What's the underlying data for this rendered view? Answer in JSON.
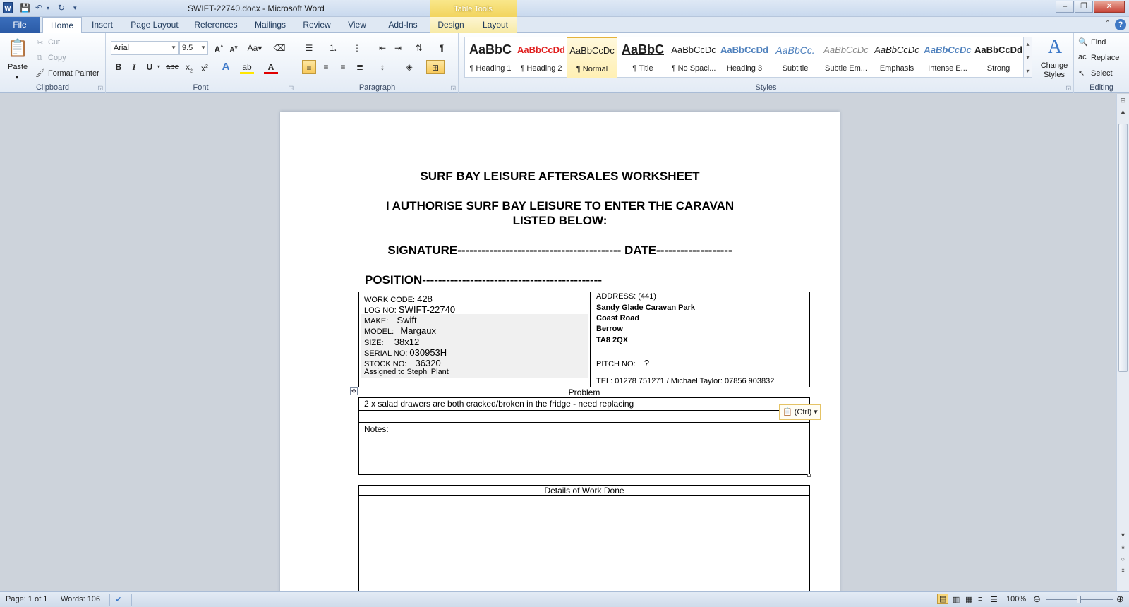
{
  "window": {
    "title": "SWIFT-22740.docx - Microsoft Word",
    "table_tools": "Table Tools",
    "app_icon": "W"
  },
  "tabs": [
    {
      "label": "File"
    },
    {
      "label": "Home"
    },
    {
      "label": "Insert"
    },
    {
      "label": "Page Layout"
    },
    {
      "label": "References"
    },
    {
      "label": "Mailings"
    },
    {
      "label": "Review"
    },
    {
      "label": "View"
    },
    {
      "label": "Add-Ins"
    },
    {
      "label": "Design"
    },
    {
      "label": "Layout"
    }
  ],
  "ribbon": {
    "clipboard": {
      "paste": "Paste",
      "cut": "Cut",
      "copy": "Copy",
      "format_painter": "Format Painter",
      "label": "Clipboard"
    },
    "font": {
      "name": "Arial",
      "size": "9.5",
      "label": "Font",
      "change_case": "Aa"
    },
    "paragraph": {
      "label": "Paragraph"
    },
    "styles": {
      "label": "Styles",
      "items": [
        {
          "preview": "AaBbC",
          "name": "¶ Heading 1"
        },
        {
          "preview": "AaBbCcDd",
          "name": "¶ Heading 2"
        },
        {
          "preview": "AaBbCcDc",
          "name": "¶ Normal"
        },
        {
          "preview": "AaBbC",
          "name": "¶ Title"
        },
        {
          "preview": "AaBbCcDc",
          "name": "¶ No Spaci..."
        },
        {
          "preview": "AaBbCcDd",
          "name": "Heading 3"
        },
        {
          "preview": "AaBbCc.",
          "name": "Subtitle"
        },
        {
          "preview": "AaBbCcDc",
          "name": "Subtle Em..."
        },
        {
          "preview": "AaBbCcDc",
          "name": "Emphasis"
        },
        {
          "preview": "AaBbCcDc",
          "name": "Intense E..."
        },
        {
          "preview": "AaBbCcDd",
          "name": "Strong"
        }
      ],
      "change_styles": "Change Styles"
    },
    "editing": {
      "find": "Find",
      "replace": "Replace",
      "select": "Select",
      "label": "Editing"
    }
  },
  "document": {
    "heading": "SURF BAY LEISURE AFTERSALES WORKSHEET",
    "authorise_line1": "I AUTHORISE SURF BAY LEISURE TO ENTER THE CARAVAN",
    "authorise_line2": "LISTED BELOW:",
    "signature_line": "SIGNATURE----------------------------------------- DATE-------------------",
    "position_line": "POSITION---------------------------------------------",
    "left_fields": [
      {
        "label": "WORK CODE:",
        "value": "428"
      },
      {
        "label": "LOG NO:",
        "value": "SWIFT-22740"
      },
      {
        "label": "MAKE:",
        "value": "Swift"
      },
      {
        "label": "MODEL:",
        "value": "Margaux"
      },
      {
        "label": "SIZE:",
        "value": "38x12"
      },
      {
        "label": "SERIAL  NO:",
        "value": "030953H"
      },
      {
        "label": "STOCK NO:",
        "value": "36320"
      }
    ],
    "assigned": "Assigned to Stephi Plant",
    "address_label": "ADDRESS:  (441)",
    "address_lines": [
      "Sandy Glade Caravan  Park",
      "Coast Road",
      "Berrow",
      "TA8 2QX"
    ],
    "pitch_label": "PITCH NO:",
    "pitch_value": "?",
    "tel": "TEL: 01278 751271  / Michael Taylor: 07856 903832",
    "problem_header": "Problem",
    "problem_text": "2 x salad drawers are both cracked/broken in the fridge - need replacing",
    "notes_label": "Notes:",
    "details_header": "Details of Work Done",
    "paste_options": "(Ctrl)"
  },
  "status": {
    "page": "Page: 1 of 1",
    "words": "Words: 106",
    "zoom": "100%"
  }
}
